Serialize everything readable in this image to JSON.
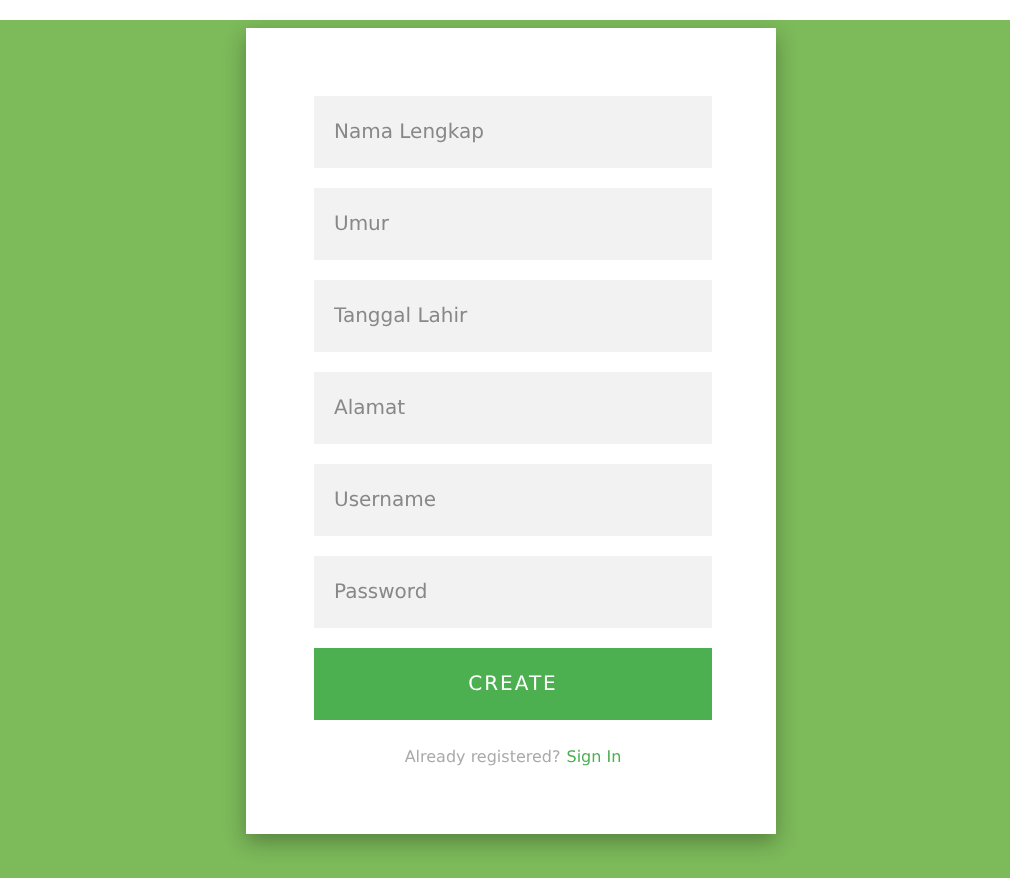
{
  "form": {
    "fields": [
      {
        "placeholder": "Nama Lengkap"
      },
      {
        "placeholder": "Umur"
      },
      {
        "placeholder": "Tanggal Lahir"
      },
      {
        "placeholder": "Alamat"
      },
      {
        "placeholder": "Username"
      },
      {
        "placeholder": "Password"
      }
    ],
    "submit_button": "CREATE",
    "footer": {
      "text": "Already registered?",
      "link": "Sign In"
    }
  }
}
